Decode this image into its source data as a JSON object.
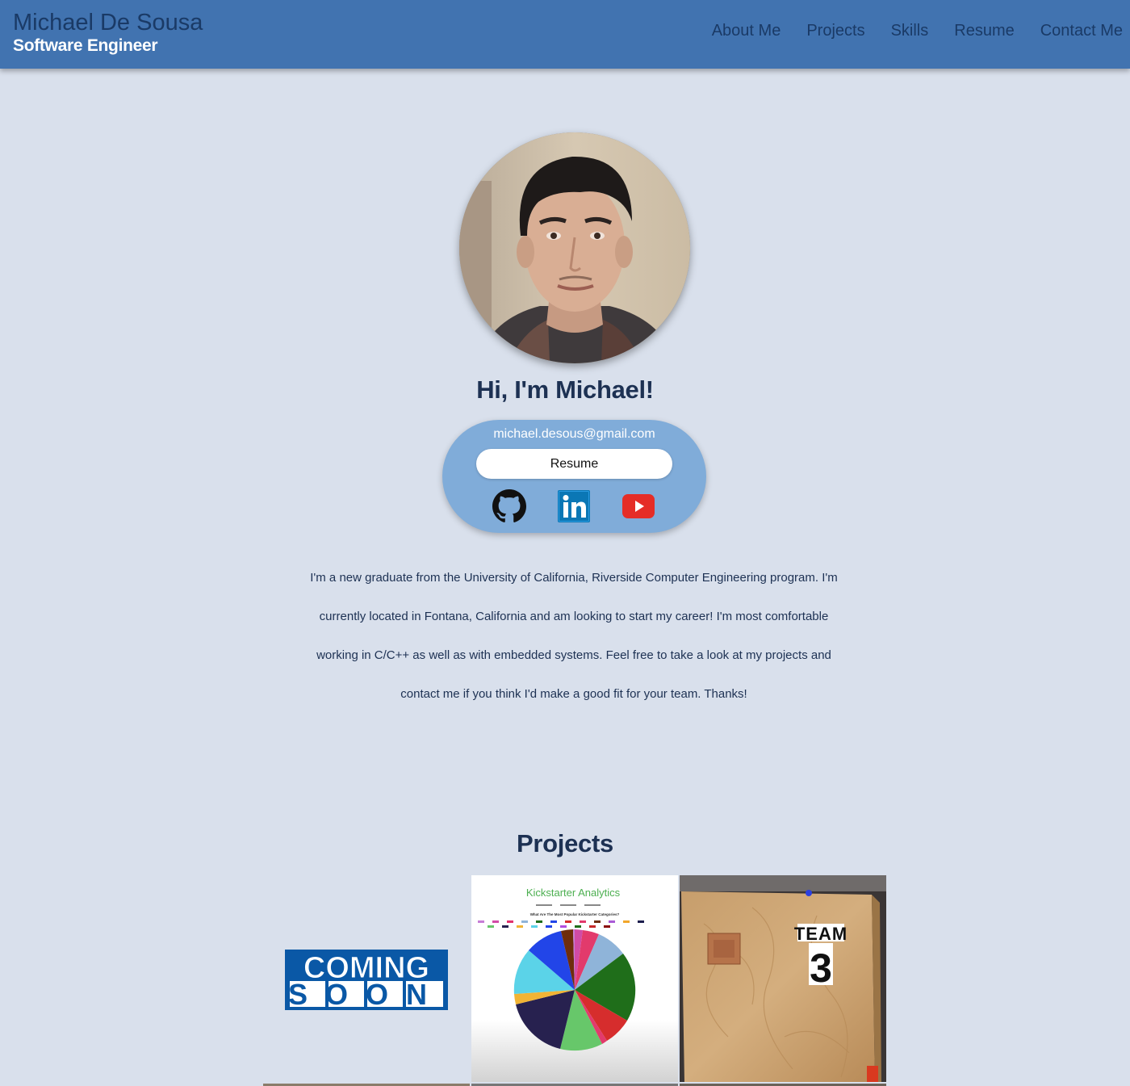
{
  "header": {
    "name": "Michael De Sousa",
    "role": "Software Engineer",
    "nav": [
      "About Me",
      "Projects",
      "Skills",
      "Resume",
      "Contact Me"
    ]
  },
  "hero": {
    "greeting": "Hi, I'm Michael!",
    "email": "michael.desous@gmail.com",
    "resume_label": "Resume",
    "social_icons": [
      "github-icon",
      "linkedin-icon",
      "youtube-icon"
    ]
  },
  "about": {
    "text": "I'm a new graduate from the University of California, Riverside Computer Engineering program. I'm currently located in Fontana, California and am looking to start my career! I'm most comfortable working in C/C++ as well as with embedded systems. Feel free to take a look at my projects and contact me if you think I'd make a good fit for your team. Thanks!"
  },
  "projects": {
    "title": "Projects",
    "items": [
      {
        "image_text": [
          "COMING",
          "SOON"
        ]
      },
      {
        "title": "Kickstarter Analytics",
        "subtitle": "What Are The Most Popular Kickstarter Categories?"
      },
      {
        "image_text": [
          "TEAM",
          "3"
        ]
      }
    ]
  },
  "colors": {
    "header": "#4173b0",
    "background": "#d9e0ec",
    "card": "#80acd9",
    "text": "#1d3153"
  }
}
